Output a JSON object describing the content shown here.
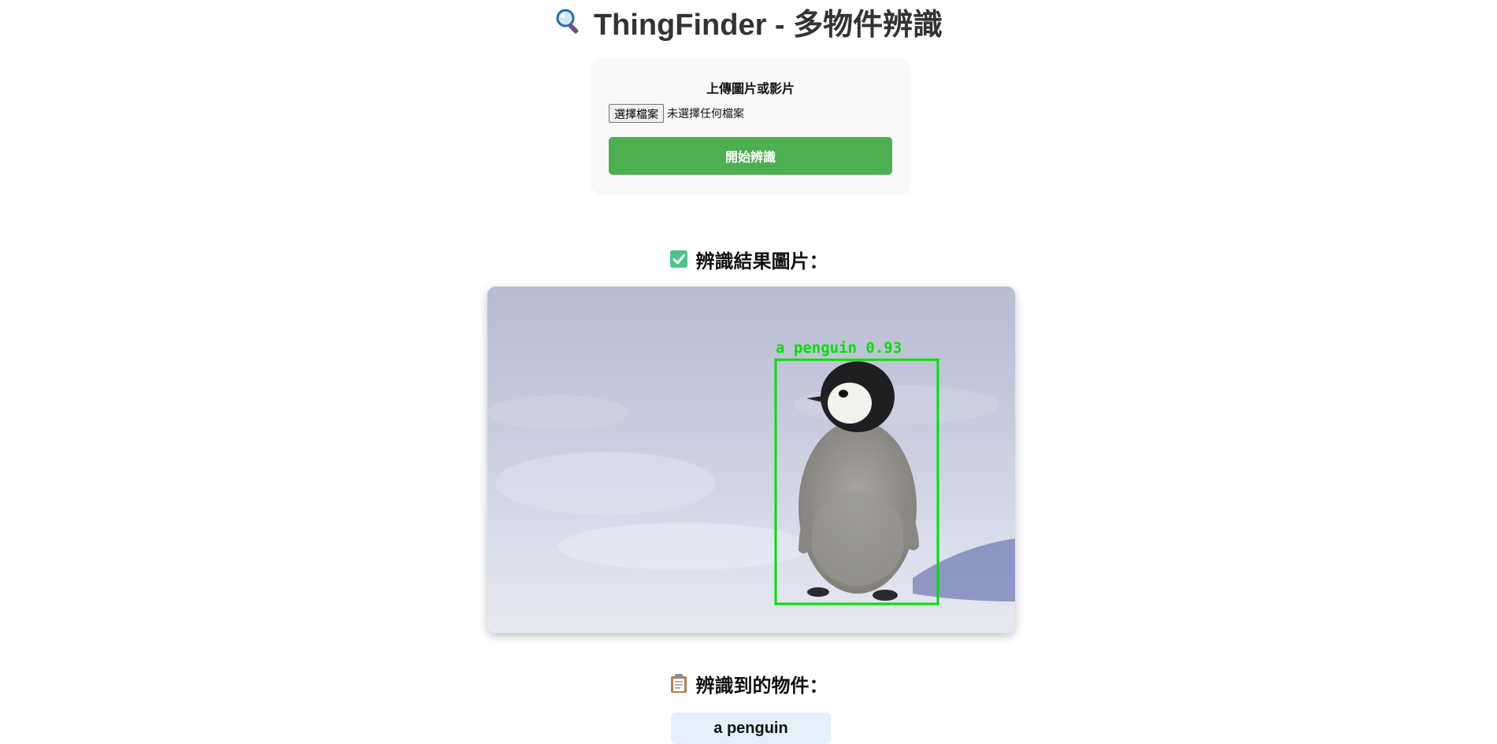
{
  "header": {
    "icon": "magnifier-icon",
    "title": "ThingFinder - 多物件辨識"
  },
  "upload": {
    "label": "上傳圖片或影片",
    "file_button": "選擇檔案",
    "file_status": "未選擇任何檔案",
    "submit_label": "開始辨識",
    "submit_color": "#4caf50"
  },
  "result": {
    "icon": "check-mark-icon",
    "heading": "辨識結果圖片：",
    "detection_label": "a penguin 0.93",
    "box_color": "#00e000"
  },
  "objects": {
    "icon": "clipboard-icon",
    "heading": "辨識到的物件：",
    "items": [
      "a penguin"
    ]
  }
}
